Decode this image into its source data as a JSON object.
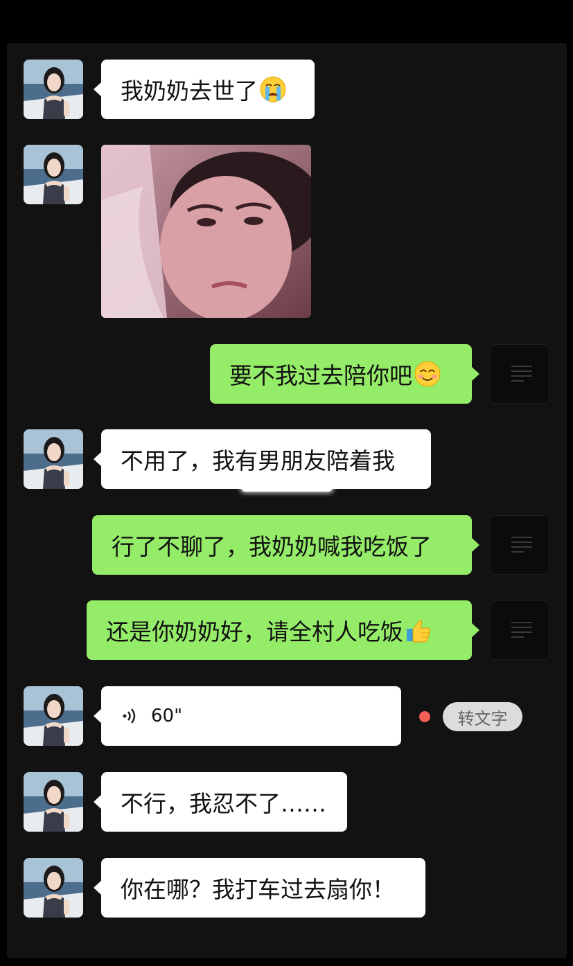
{
  "messages": [
    {
      "sender": "contact",
      "type": "text",
      "text": "我奶奶去世了",
      "emoji": "crying-face"
    },
    {
      "sender": "contact",
      "type": "image",
      "image": "crying-selfie"
    },
    {
      "sender": "self",
      "type": "text",
      "text": "要不我过去陪你吧",
      "emoji": "smiling-face"
    },
    {
      "sender": "contact",
      "type": "text",
      "text": "不用了，我有男朋友陪着我"
    },
    {
      "sender": "self",
      "type": "text",
      "text": "行了不聊了，我奶奶喊我吃饭了"
    },
    {
      "sender": "self",
      "type": "text",
      "text": "还是你奶奶好，请全村人吃饭",
      "emoji": "thumbs-up"
    },
    {
      "sender": "contact",
      "type": "voice",
      "duration": "60\"",
      "transcribe_label": "转文字",
      "unread": true
    },
    {
      "sender": "contact",
      "type": "text",
      "text": "不行，我忍不了……"
    },
    {
      "sender": "contact",
      "type": "text",
      "text": "你在哪？我打车过去扇你！"
    }
  ],
  "colors": {
    "background": "#121212",
    "incoming_bubble": "#ffffff",
    "outgoing_bubble": "#95ec69",
    "unread_dot": "#f25f54",
    "transcribe_pill": "#dcdcdc"
  },
  "icons": [
    "crying-face-emoji",
    "smiling-face-emoji",
    "thumbs-up-emoji",
    "voice-wave-icon"
  ]
}
